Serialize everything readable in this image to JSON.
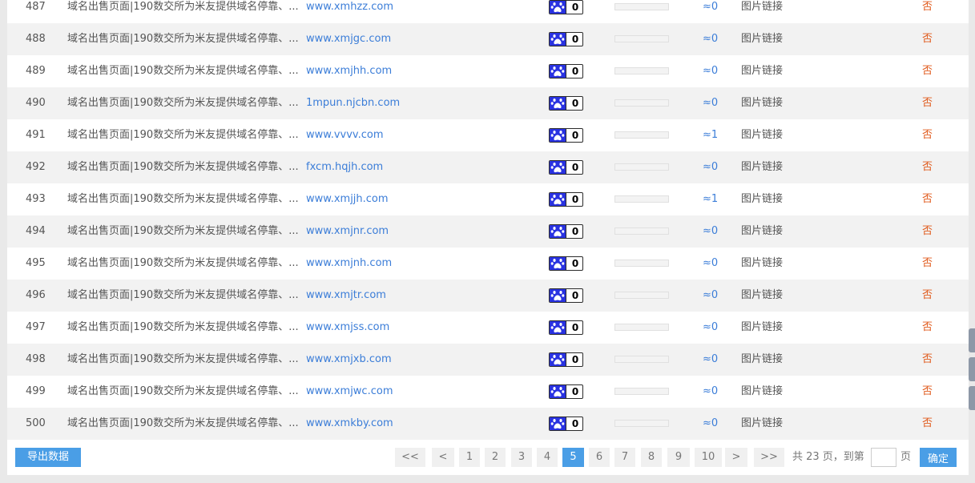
{
  "rows": [
    {
      "num": "487",
      "title": "域名出售页面|190数交所为米友提供域名停靠、...",
      "domain": "www.xmhzz.com",
      "baidu": "0",
      "approx": "≈0",
      "link": "图片链接",
      "flag": "否"
    },
    {
      "num": "488",
      "title": "域名出售页面|190数交所为米友提供域名停靠、...",
      "domain": "www.xmjgc.com",
      "baidu": "0",
      "approx": "≈0",
      "link": "图片链接",
      "flag": "否"
    },
    {
      "num": "489",
      "title": "域名出售页面|190数交所为米友提供域名停靠、...",
      "domain": "www.xmjhh.com",
      "baidu": "0",
      "approx": "≈0",
      "link": "图片链接",
      "flag": "否"
    },
    {
      "num": "490",
      "title": "域名出售页面|190数交所为米友提供域名停靠、...",
      "domain": "1mpun.njcbn.com",
      "baidu": "0",
      "approx": "≈0",
      "link": "图片链接",
      "flag": "否"
    },
    {
      "num": "491",
      "title": "域名出售页面|190数交所为米友提供域名停靠、...",
      "domain": "www.vvvv.com",
      "baidu": "0",
      "approx": "≈1",
      "link": "图片链接",
      "flag": "否"
    },
    {
      "num": "492",
      "title": "域名出售页面|190数交所为米友提供域名停靠、...",
      "domain": "fxcm.hqjh.com",
      "baidu": "0",
      "approx": "≈0",
      "link": "图片链接",
      "flag": "否"
    },
    {
      "num": "493",
      "title": "域名出售页面|190数交所为米友提供域名停靠、...",
      "domain": "www.xmjjh.com",
      "baidu": "0",
      "approx": "≈1",
      "link": "图片链接",
      "flag": "否"
    },
    {
      "num": "494",
      "title": "域名出售页面|190数交所为米友提供域名停靠、...",
      "domain": "www.xmjnr.com",
      "baidu": "0",
      "approx": "≈0",
      "link": "图片链接",
      "flag": "否"
    },
    {
      "num": "495",
      "title": "域名出售页面|190数交所为米友提供域名停靠、...",
      "domain": "www.xmjnh.com",
      "baidu": "0",
      "approx": "≈0",
      "link": "图片链接",
      "flag": "否"
    },
    {
      "num": "496",
      "title": "域名出售页面|190数交所为米友提供域名停靠、...",
      "domain": "www.xmjtr.com",
      "baidu": "0",
      "approx": "≈0",
      "link": "图片链接",
      "flag": "否"
    },
    {
      "num": "497",
      "title": "域名出售页面|190数交所为米友提供域名停靠、...",
      "domain": "www.xmjss.com",
      "baidu": "0",
      "approx": "≈0",
      "link": "图片链接",
      "flag": "否"
    },
    {
      "num": "498",
      "title": "域名出售页面|190数交所为米友提供域名停靠、...",
      "domain": "www.xmjxb.com",
      "baidu": "0",
      "approx": "≈0",
      "link": "图片链接",
      "flag": "否"
    },
    {
      "num": "499",
      "title": "域名出售页面|190数交所为米友提供域名停靠、...",
      "domain": "www.xmjwc.com",
      "baidu": "0",
      "approx": "≈0",
      "link": "图片链接",
      "flag": "否"
    },
    {
      "num": "500",
      "title": "域名出售页面|190数交所为米友提供域名停靠、...",
      "domain": "www.xmkby.com",
      "baidu": "0",
      "approx": "≈0",
      "link": "图片链接",
      "flag": "否"
    }
  ],
  "row_bar_level": 0,
  "icons": {
    "baidu": "baidu-paw-icon"
  },
  "colors": {
    "accent": "#4a9ee6",
    "link": "#3b7dd8",
    "negative": "#e05a1c",
    "baidu": "#2932e1"
  },
  "footer": {
    "export_label": "导出数据",
    "pagination": [
      "<<",
      "<",
      "1",
      "2",
      "3",
      "4",
      "5",
      "6",
      "7",
      "8",
      "9",
      "10",
      ">",
      ">>"
    ],
    "current_page": "5",
    "pages_info": "共 23 页，到第",
    "page_input_value": "",
    "page_suffix": "页",
    "confirm_label": "确定"
  }
}
